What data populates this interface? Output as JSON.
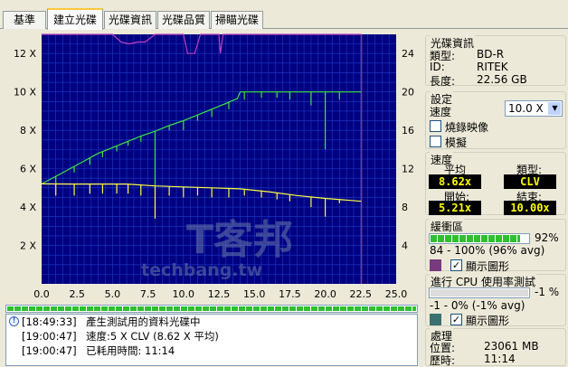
{
  "tabs": [
    "基準",
    "建立光碟",
    "光碟資訊",
    "光碟品質",
    "掃瞄光碟"
  ],
  "active_tab_index": 1,
  "chart_data": {
    "type": "line",
    "xlabel": "",
    "ylabel": "",
    "xlim": [
      0,
      25
    ],
    "ylim_left": [
      0,
      13
    ],
    "ylim_right": [
      0,
      26
    ],
    "x_ticks": [
      "0.0",
      "2.5",
      "5.0",
      "7.5",
      "10.0",
      "12.5",
      "15.0",
      "17.5",
      "20.0",
      "22.5",
      "25.0"
    ],
    "y_left_ticks": [
      "2 X",
      "4 X",
      "6 X",
      "8 X",
      "10 X",
      "12 X"
    ],
    "y_right_ticks": [
      "4",
      "8",
      "12",
      "16",
      "20",
      "24"
    ],
    "end_marker_x": 22.56,
    "grid": true,
    "watermark": [
      "T客邦",
      "techbang.tw"
    ],
    "series": [
      {
        "color": "#3fe63f",
        "points": [
          [
            0,
            5.21
          ],
          [
            1,
            5.6
          ],
          [
            2,
            6.0
          ],
          [
            3,
            6.4
          ],
          [
            4,
            6.8
          ],
          [
            5,
            7.1
          ],
          [
            6,
            7.4
          ],
          [
            7,
            7.7
          ],
          [
            8,
            7.95
          ],
          [
            9,
            8.25
          ],
          [
            10,
            8.5
          ],
          [
            11,
            8.8
          ],
          [
            12,
            9.1
          ],
          [
            13,
            9.4
          ],
          [
            13.8,
            9.65
          ],
          [
            14,
            10.0
          ],
          [
            16,
            10.0
          ],
          [
            18,
            10.0
          ],
          [
            19,
            10.0
          ],
          [
            20,
            10.0
          ],
          [
            22.56,
            10.0
          ]
        ],
        "dips": [
          [
            1.0,
            5.2
          ],
          [
            2.3,
            5.8
          ],
          [
            3.4,
            6.2
          ],
          [
            4.3,
            6.6
          ],
          [
            5.3,
            6.9
          ],
          [
            6.1,
            7.2
          ],
          [
            7.0,
            7.4
          ],
          [
            8.0,
            5.1
          ],
          [
            9.0,
            8.0
          ],
          [
            10.0,
            8.0
          ],
          [
            11.0,
            8.5
          ],
          [
            12.0,
            8.7
          ],
          [
            13.2,
            9.1
          ],
          [
            14.3,
            9.6
          ],
          [
            15.5,
            9.7
          ],
          [
            16.6,
            9.7
          ],
          [
            17.5,
            9.6
          ],
          [
            19.0,
            9.3
          ],
          [
            20.0,
            7.0
          ],
          [
            21.0,
            9.6
          ]
        ]
      },
      {
        "color": "#ffff40",
        "points": [
          [
            0,
            5.21
          ],
          [
            2,
            5.2
          ],
          [
            4,
            5.2
          ],
          [
            6,
            5.2
          ],
          [
            8,
            5.1
          ],
          [
            10,
            5.05
          ],
          [
            12,
            5.0
          ],
          [
            14,
            4.95
          ],
          [
            16,
            4.8
          ],
          [
            18,
            4.6
          ],
          [
            20,
            4.45
          ],
          [
            22.56,
            4.3
          ]
        ],
        "dips": [
          [
            1.0,
            4.6
          ],
          [
            2.3,
            4.6
          ],
          [
            3.4,
            4.7
          ],
          [
            4.3,
            4.7
          ],
          [
            5.3,
            4.7
          ],
          [
            6.1,
            4.7
          ],
          [
            7.0,
            4.6
          ],
          [
            8.0,
            3.4
          ],
          [
            9.0,
            4.6
          ],
          [
            10.0,
            4.5
          ],
          [
            11.0,
            4.6
          ],
          [
            12.0,
            4.5
          ],
          [
            13.2,
            4.5
          ],
          [
            14.3,
            4.6
          ],
          [
            15.5,
            4.5
          ],
          [
            16.6,
            4.4
          ],
          [
            17.5,
            4.3
          ],
          [
            19.0,
            4.0
          ],
          [
            20.0,
            3.5
          ],
          [
            21.0,
            4.2
          ]
        ]
      },
      {
        "color": "#c040c0",
        "points": [
          [
            0,
            13.0
          ],
          [
            5,
            13.0
          ],
          [
            5.6,
            12.6
          ],
          [
            6.2,
            12.5
          ],
          [
            6.8,
            12.6
          ],
          [
            7.3,
            12.6
          ],
          [
            8.0,
            13.0
          ],
          [
            10,
            13.0
          ],
          [
            10.3,
            12.0
          ],
          [
            10.8,
            12.0
          ],
          [
            11.2,
            13.0
          ],
          [
            12.5,
            13.0
          ],
          [
            12.6,
            12.0
          ],
          [
            12.8,
            13.0
          ],
          [
            22.56,
            13.0
          ]
        ]
      }
    ]
  },
  "progress_percent": 100,
  "log": [
    {
      "time": "[18:49:33]",
      "message": "產生測試用的資料光碟中",
      "icon": "info-icon"
    },
    {
      "time": "[19:00:47]",
      "message": "速度:5 X CLV (8.62 X 平均)",
      "icon": ""
    },
    {
      "time": "[19:00:47]",
      "message": "已耗用時間: 11:14",
      "icon": ""
    }
  ],
  "disc_info": {
    "title": "光碟資訊",
    "type_label": "類型:",
    "type_value": "BD-R",
    "id_label": "ID:",
    "id_value": "RITEK",
    "length_label": "長度:",
    "length_value": "22.56 GB"
  },
  "settings": {
    "title": "設定",
    "speed_label": "速度",
    "speed_value": "10.0 X",
    "mirror_label": "燒錄映像",
    "simulate_label": "模擬"
  },
  "speed": {
    "title": "速度",
    "avg_label": "平均",
    "avg_value": "8.62x",
    "type_label": "類型:",
    "type_value": "CLV",
    "start_label": "開始:",
    "start_value": "5.21x",
    "end_label": "結束:",
    "end_value": "10.00x"
  },
  "buffer": {
    "title": "緩衝區",
    "percent": "92%",
    "fill_fraction": 0.92,
    "range_text": "84 - 100% (96% avg)",
    "show_graph_label": "顯示圖形",
    "color": "#7a3a80"
  },
  "cpu": {
    "title": "進行 CPU 使用率測試",
    "percent": "-1 %",
    "range_text": "-1 - 0% (-1% avg)",
    "show_graph_label": "顯示圖形",
    "color": "#3a7070"
  },
  "process": {
    "title": "處理",
    "position_label": "位置:",
    "position_value": "23061 MB",
    "elapsed_label": "歷時:",
    "elapsed_value": "11:14"
  }
}
